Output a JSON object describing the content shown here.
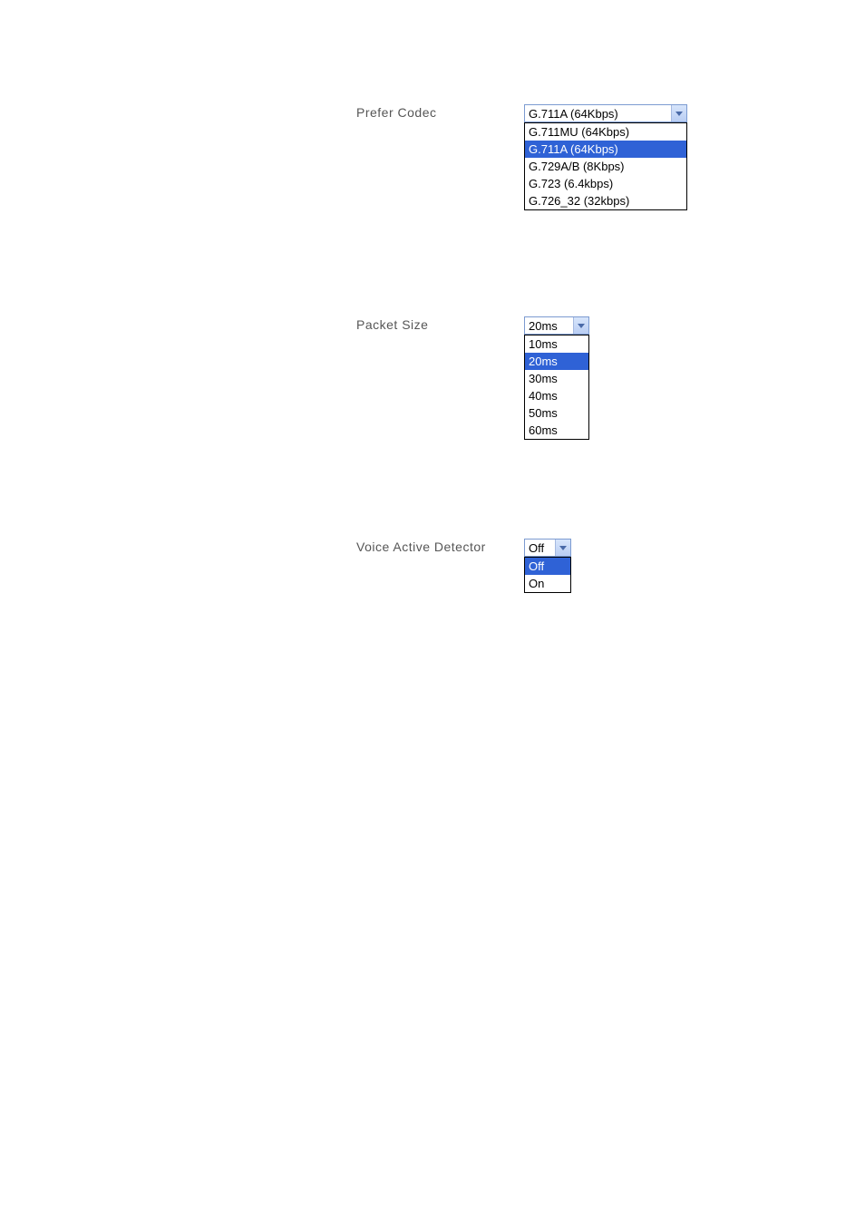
{
  "codec": {
    "label": "Prefer Codec",
    "selected": "G.711A (64Kbps)",
    "options": [
      "G.711MU (64Kbps)",
      "G.711A (64Kbps)",
      "G.729A/B (8Kbps)",
      "G.723 (6.4kbps)",
      "G.726_32 (32kbps)"
    ],
    "selected_index": 1
  },
  "packet": {
    "label": "Packet Size",
    "selected": "20ms",
    "options": [
      "10ms",
      "20ms",
      "30ms",
      "40ms",
      "50ms",
      "60ms"
    ],
    "selected_index": 1
  },
  "vad": {
    "label": "Voice Active Detector",
    "selected": "Off",
    "options": [
      "Off",
      "On"
    ],
    "selected_index": 0
  }
}
